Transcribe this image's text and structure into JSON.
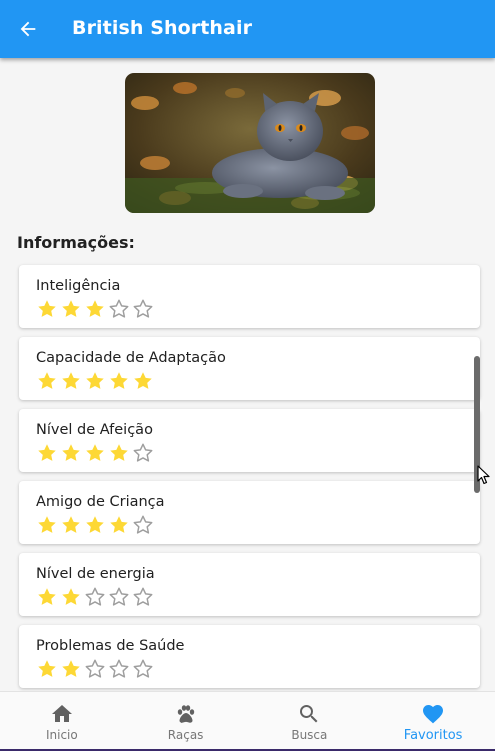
{
  "appbar": {
    "title": "British Shorthair"
  },
  "section_title": "Informações:",
  "star_max": 5,
  "ratings": [
    {
      "label": "Inteligência",
      "value": 3
    },
    {
      "label": "Capacidade de Adaptação",
      "value": 5
    },
    {
      "label": "Nível de Afeição",
      "value": 4
    },
    {
      "label": "Amigo de Criança",
      "value": 4
    },
    {
      "label": "Nível de energia",
      "value": 2
    },
    {
      "label": "Problemas de Saúde",
      "value": 2
    }
  ],
  "nav": [
    {
      "label": "Inicio",
      "icon": "home-icon"
    },
    {
      "label": "Raças",
      "icon": "paw-icon"
    },
    {
      "label": "Busca",
      "icon": "search-icon"
    },
    {
      "label": "Favoritos",
      "icon": "heart-icon",
      "active": true
    }
  ],
  "colors": {
    "primary": "#2196f3",
    "star_filled": "#fdd835",
    "star_empty": "#9e9e9e"
  }
}
